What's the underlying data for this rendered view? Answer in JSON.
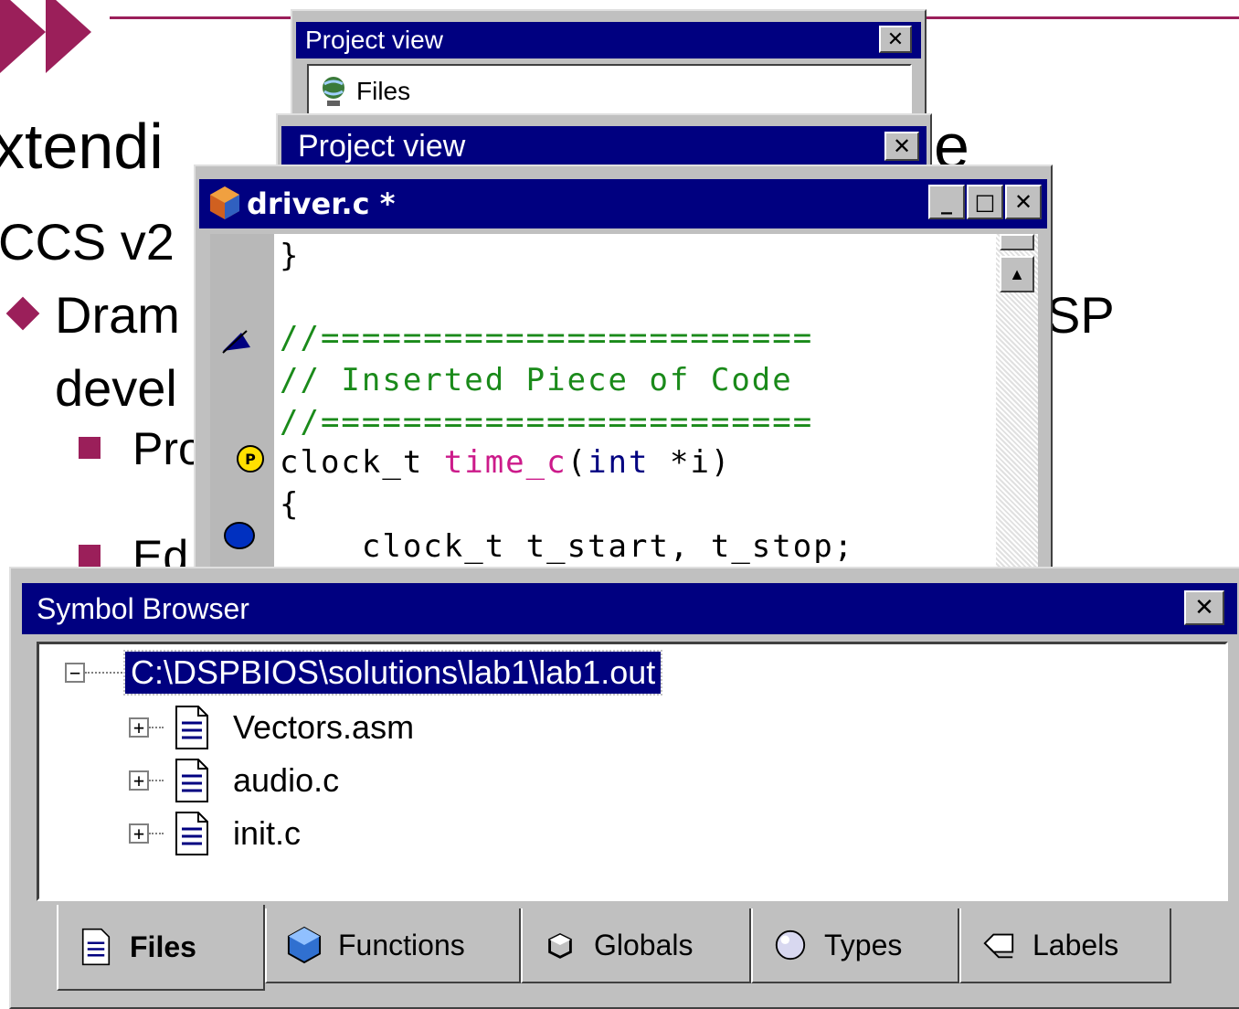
{
  "slide": {
    "title_fragment": "xtendi",
    "title_tail": "e",
    "ccs": "CCS v2",
    "dram": "Dram",
    "dsp": "SP",
    "devel": "devel",
    "pro": "Pro",
    "ed": "Ed",
    "accent_color": "#9b1f5a"
  },
  "project_view_back": {
    "title": "Project view",
    "close": "✕",
    "files_label": "Files"
  },
  "project_view_front": {
    "title": "Project view",
    "close": "✕"
  },
  "editor": {
    "title": "driver.c *",
    "min": "_",
    "max": "□",
    "close": "✕",
    "lines": [
      "}",
      "",
      "//========================",
      "// Inserted Piece of Code",
      "//========================",
      "clock_t time_c(int *i)",
      "{",
      "    clock_t t_start, t_stop;"
    ],
    "code_tokens": {
      "l5a": "clock_t ",
      "l5b": "time_c",
      "l5c": "(",
      "l5d": "int",
      "l5e": " *i)"
    }
  },
  "symbol_browser": {
    "title": "Symbol Browser",
    "close": "✕",
    "root": "C:\\DSPBIOS\\solutions\\lab1\\lab1.out",
    "items": [
      "Vectors.asm",
      "audio.c",
      "init.c"
    ],
    "tabs": [
      "Files",
      "Functions",
      "Globals",
      "Types",
      "Labels"
    ],
    "active_tab": "Files"
  }
}
